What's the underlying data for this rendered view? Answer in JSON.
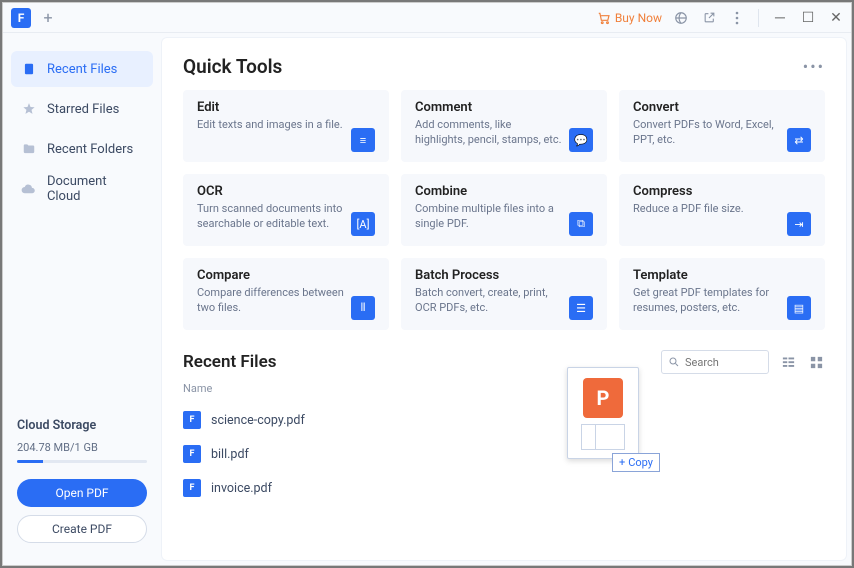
{
  "titlebar": {
    "buy_now": "Buy Now"
  },
  "sidebar": {
    "items": [
      {
        "label": "Recent Files"
      },
      {
        "label": "Starred Files"
      },
      {
        "label": "Recent Folders"
      },
      {
        "label": "Document Cloud"
      }
    ],
    "cloud_storage_title": "Cloud Storage",
    "cloud_storage_usage": "204.78 MB/1 GB",
    "open_pdf": "Open PDF",
    "create_pdf": "Create PDF"
  },
  "quick_tools": {
    "title": "Quick Tools",
    "cards": [
      {
        "title": "Edit",
        "desc": "Edit texts and images in a file."
      },
      {
        "title": "Comment",
        "desc": "Add comments, like highlights, pencil, stamps, etc."
      },
      {
        "title": "Convert",
        "desc": "Convert PDFs to Word, Excel, PPT, etc."
      },
      {
        "title": "OCR",
        "desc": "Turn scanned documents into searchable or editable text."
      },
      {
        "title": "Combine",
        "desc": "Combine multiple files into a single PDF."
      },
      {
        "title": "Compress",
        "desc": "Reduce a PDF file size."
      },
      {
        "title": "Compare",
        "desc": "Compare differences between two files."
      },
      {
        "title": "Batch Process",
        "desc": "Batch convert, create, print, OCR PDFs, etc."
      },
      {
        "title": "Template",
        "desc": "Get great PDF templates for resumes, posters, etc."
      }
    ]
  },
  "recent_files": {
    "title": "Recent Files",
    "column_header": "Name",
    "search_placeholder": "Search",
    "files": [
      {
        "name": "science-copy.pdf"
      },
      {
        "name": "bill.pdf"
      },
      {
        "name": "invoice.pdf"
      }
    ]
  },
  "drag_tooltip": "Copy"
}
